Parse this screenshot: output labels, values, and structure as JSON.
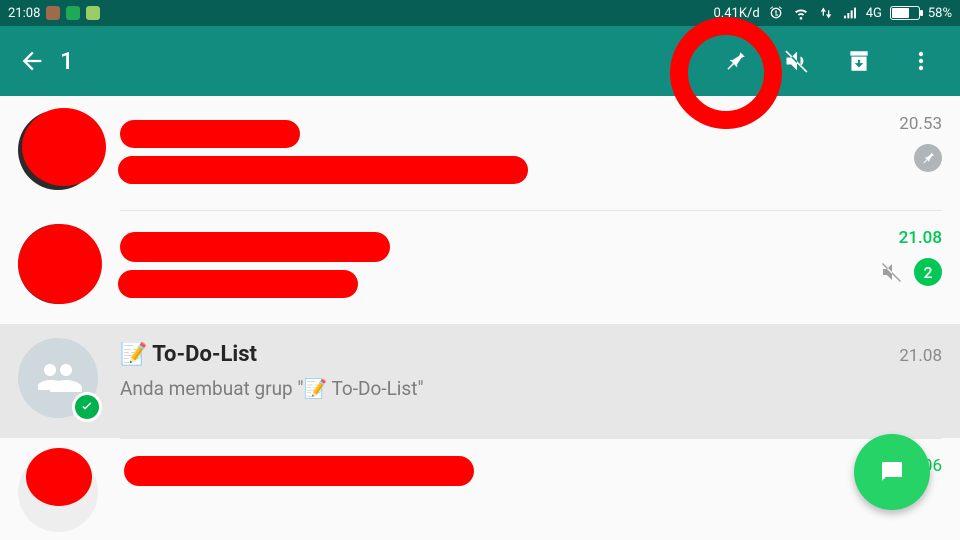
{
  "status_bar": {
    "time": "21:08",
    "data_rate": "0.41K/d",
    "network_label": "4G",
    "battery_pct": "58%"
  },
  "action_bar": {
    "selected_count": "1"
  },
  "chats": [
    {
      "name": "",
      "msg": "",
      "time": "20.53"
    },
    {
      "name": "",
      "msg": "",
      "time": "21.08",
      "unread": "2"
    },
    {
      "name": "📝 To-Do-List",
      "msg": "Anda membuat grup \"📝 To-Do-List\"",
      "time": "21.08"
    },
    {
      "name": "",
      "msg": "",
      "time": "21.06"
    }
  ]
}
